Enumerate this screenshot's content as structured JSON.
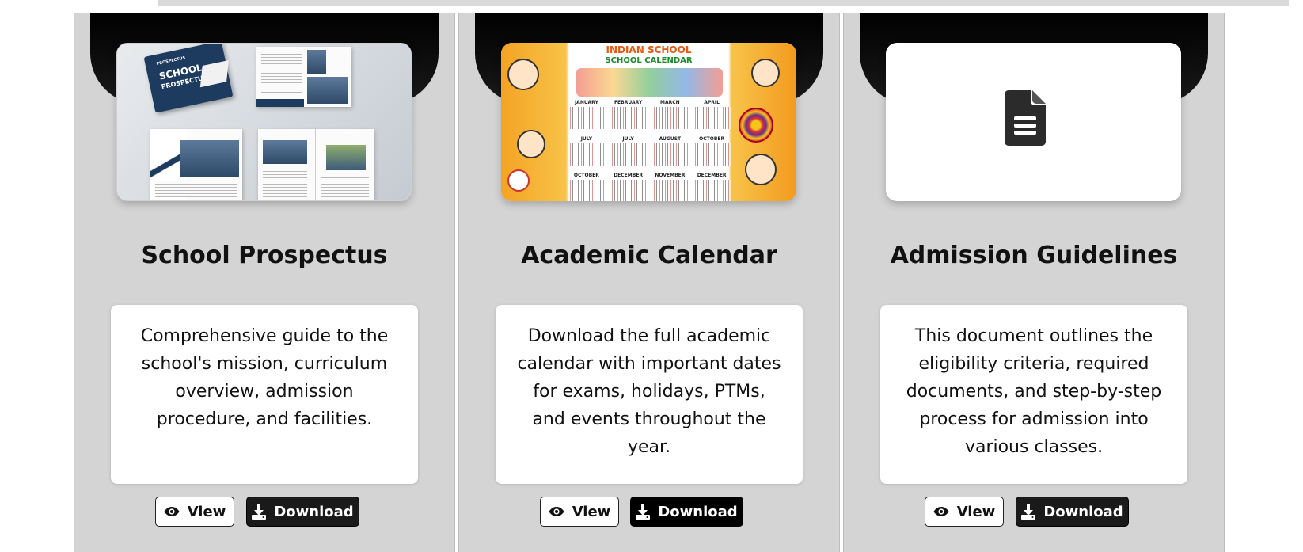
{
  "cards": [
    {
      "title": "School Prospectus",
      "description": "Comprehensive guide to the school's mission, curriculum overview, admission procedure, and facilities.",
      "thumb_text": {
        "cover_small": "PROSPECTUS",
        "cover_big": "SCHOOL",
        "cover_sub": "PROSPECTUS"
      },
      "view_label": "View",
      "download_label": "Download"
    },
    {
      "title": "Academic Calendar",
      "description": "Download the full academic calendar with important dates for exams, holidays, PTMs, and events throughout the year.",
      "thumb_text": {
        "heading": "INDIAN SCHOOL",
        "subheading": "SCHOOL CALENDAR",
        "months": [
          "JANUARY",
          "FEBRUARY",
          "MARCH",
          "APRIL",
          "JULY",
          "JULY",
          "AUGUST",
          "OCTOBER",
          "OCTOBER",
          "DECEMBER",
          "NOVEMBER",
          "DECEMBER"
        ]
      },
      "view_label": "View",
      "download_label": "Download"
    },
    {
      "title": "Admission Guidelines",
      "description": "This document outlines the eligibility criteria, required documents, and step-by-step process for admission into various classes.",
      "thumb_icon": "document-icon",
      "view_label": "View",
      "download_label": "Download"
    }
  ],
  "icons": {
    "view": "eye-icon",
    "download": "download-icon"
  },
  "colors": {
    "card_bg": "#d4d4d4",
    "accent_dark": "#1a1a1a",
    "calendar_orange": "#f4a323"
  }
}
